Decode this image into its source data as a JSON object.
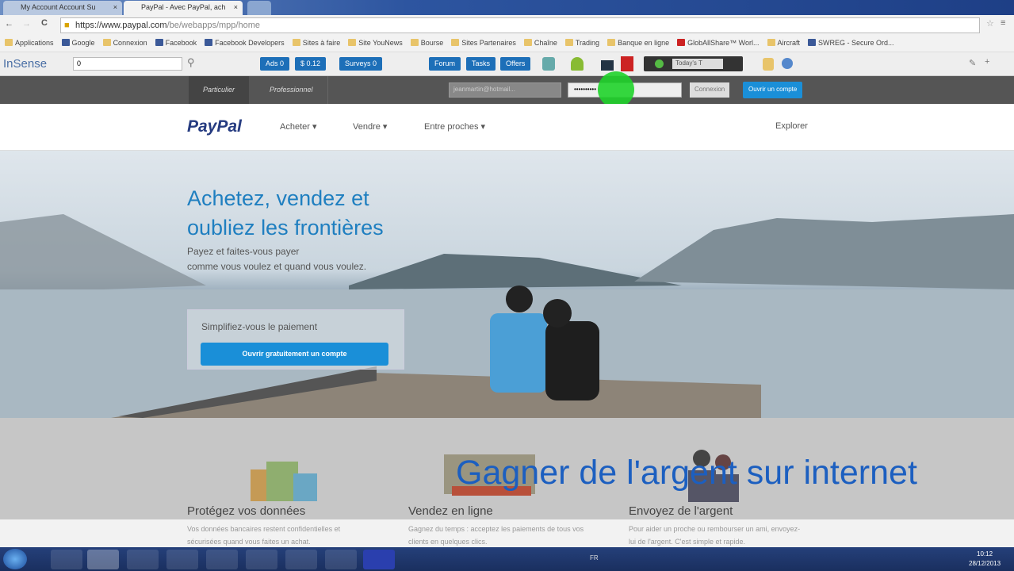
{
  "browser": {
    "tabs": [
      {
        "label": "My Account Account Su"
      },
      {
        "label": "PayPal - Avec PayPal, ach"
      }
    ],
    "url_host": "https://www.paypal.com",
    "url_path": "/be/webapps/mpp/home",
    "bookmarks": [
      "Applications",
      "Google",
      "Connexion",
      "Facebook",
      "Facebook Developers",
      "Sites à faire",
      "Site YouNews",
      "Bourse",
      "Sites Partenaires",
      "Chaîne",
      "Trading",
      "Banque en ligne",
      "GlobAllShare™ Worl...",
      "Aircraft",
      "SWREG - Secure Ord..."
    ]
  },
  "toolbar": {
    "brand": "InSense",
    "search_value": "0",
    "buttons": [
      "Ads 0",
      "$ 0.12",
      "Surveys 0",
      "Forum",
      "Tasks",
      "Offers"
    ],
    "dropdown": "Today's T"
  },
  "paypal": {
    "tabs": [
      "Particulier",
      "Professionnel"
    ],
    "email_placeholder": "jeanmartin@hotmail...",
    "password": "••••••••••",
    "login": "Connexion",
    "signup": "Ouvrir un compte",
    "logo": "PayPal",
    "nav": [
      "Acheter",
      "Vendre",
      "Entre proches",
      "Explorer"
    ],
    "hero_title_1": "Achetez, vendez et",
    "hero_title_2": "oubliez les frontières",
    "hero_sub_1": "Payez et faites-vous payer",
    "hero_sub_2": "comme vous voulez et quand vous voulez.",
    "cta_label": "Simplifiez-vous le paiement",
    "cta_button": "Ouvrir gratuitement un compte",
    "features": [
      {
        "title": "Protégez vos données",
        "text": "Vos données bancaires restent confidentielles et sécurisées quand vous faites un achat."
      },
      {
        "title": "Vendez en ligne",
        "text": "Gagnez du temps : acceptez les paiements de tous vos clients en quelques clics."
      },
      {
        "title": "Envoyez de l'argent",
        "text": "Pour aider un proche ou rembourser un ami, envoyez-lui de l'argent. C'est simple et rapide."
      }
    ]
  },
  "overlay": {
    "caption": "Gagner de l'argent sur internet"
  },
  "taskbar": {
    "lang": "FR",
    "time": "10:12",
    "date": "28/12/2013"
  }
}
